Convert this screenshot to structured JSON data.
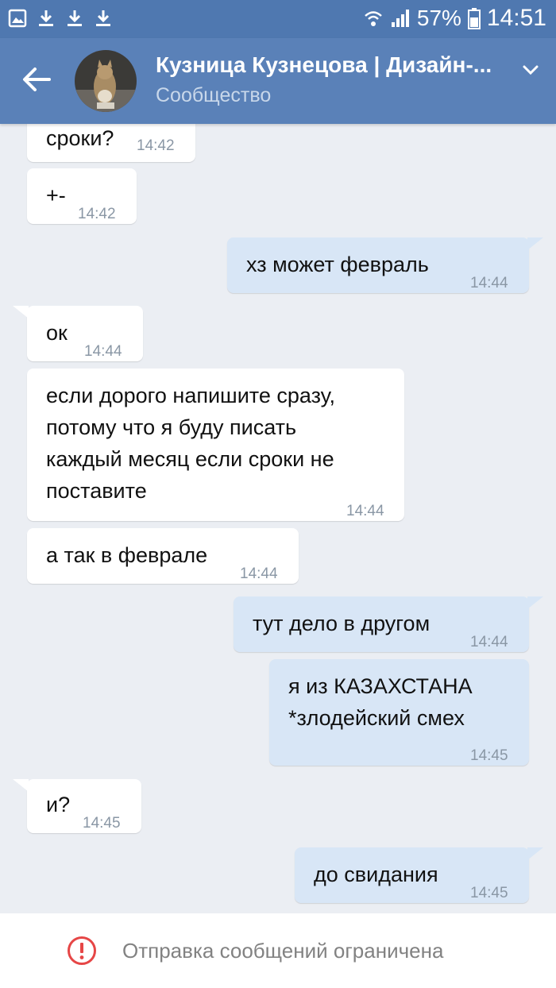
{
  "status_bar": {
    "left_icons": [
      "image-icon",
      "download-icon",
      "download-icon",
      "download-icon"
    ],
    "battery_percent": "57%",
    "time": "14:51"
  },
  "header": {
    "title": "Кузница Кузнецова | Дизайн-...",
    "subtitle": "Сообщество"
  },
  "messages": [
    {
      "dir": "in",
      "text": "сроки?",
      "time": "14:42"
    },
    {
      "dir": "in",
      "text": "+-",
      "time": "14:42"
    },
    {
      "dir": "out",
      "text": "хз может февраль",
      "time": "14:44"
    },
    {
      "dir": "in",
      "text": "ок",
      "time": "14:44"
    },
    {
      "dir": "in",
      "text": "если дорого напишите сразу,\nпотому что я буду писать\nкаждый месяц если сроки не\nпоставите",
      "time": "14:44"
    },
    {
      "dir": "in",
      "text": "а так в феврале",
      "time": "14:44"
    },
    {
      "dir": "out",
      "text": "тут дело в другом",
      "time": "14:44"
    },
    {
      "dir": "out",
      "text": "я из КАЗАХСТАНА\n*злодейский смех",
      "time": "14:45"
    },
    {
      "dir": "in",
      "text": "и?",
      "time": "14:45"
    },
    {
      "dir": "out",
      "text": "до свидания",
      "time": "14:45"
    }
  ],
  "footer": {
    "notice": "Отправка сообщений ограничена"
  },
  "colors": {
    "header": "#5a81b8",
    "status_bar": "#4f78b0",
    "chat_bg": "#ebeef3",
    "incoming": "#ffffff",
    "outgoing": "#d8e6f6",
    "warning": "#e64646"
  }
}
